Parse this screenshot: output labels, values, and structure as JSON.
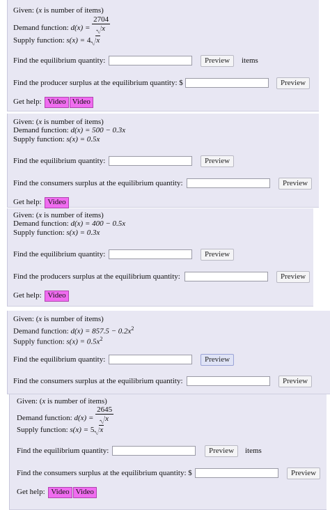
{
  "panels": [
    {
      "given": "Given: (",
      "given_var": "x",
      "given_rest": " is number of items)",
      "demand_label": "Demand function: ",
      "demand_lhs": "d(x) = ",
      "demand_num": "2704",
      "demand_den": "x",
      "supply_label": "Supply function: ",
      "supply_lhs": "s(x) = ",
      "supply_coef": "4",
      "supply_rad": "x",
      "q1": "Find the equilibrium quantity:",
      "preview1": "Preview",
      "unit": "items",
      "q2": "Find the producer surplus at the equilibrium quantity: $",
      "preview2": "Preview",
      "help": "Get help:",
      "video1": "Video",
      "video2": "Video"
    },
    {
      "given": "Given: (",
      "given_var": "x",
      "given_rest": " is number of items)",
      "demand_label": "Demand function: ",
      "demand_expr": "d(x) = 500 − 0.3x",
      "supply_label": "Supply function: ",
      "supply_expr": "s(x) = 0.5x",
      "q1": "Find the equilibrium quantity:",
      "preview1": "Preview",
      "q2": "Find the consumers surplus at the equilibrium quantity:",
      "preview2": "Preview",
      "help": "Get help:",
      "video1": "Video"
    },
    {
      "given": "Given: (",
      "given_var": "x",
      "given_rest": " is number of items)",
      "demand_label": "Demand function: ",
      "demand_expr": "d(x) = 400 − 0.5x",
      "supply_label": "Supply function: ",
      "supply_expr": "s(x) = 0.3x",
      "q1": "Find the equilibrium quantity:",
      "preview1": "Preview",
      "q2": "Find the producers surplus at the equilibrium quantity:",
      "preview2": "Preview",
      "help": "Get help:",
      "video1": "Video"
    },
    {
      "given": "Given: (",
      "given_var": "x",
      "given_rest": " is number of items)",
      "demand_label": "Demand function: ",
      "demand_expr": "d(x) = 857.5 − 0.2x",
      "demand_exp": "2",
      "supply_label": "Supply function: ",
      "supply_expr": "s(x) = 0.5x",
      "supply_exp": "2",
      "q1": "Find the equilibrium quantity:",
      "preview1": "Preview",
      "q2": "Find the consumers surplus at the equilibrium quantity:",
      "preview2": "Preview"
    },
    {
      "given": "Given: (",
      "given_var": "x",
      "given_rest": " is number of items)",
      "demand_label": "Demand function: ",
      "demand_lhs": "d(x) = ",
      "demand_num": "2645",
      "demand_den": "x",
      "supply_label": "Supply function: ",
      "supply_lhs": "s(x) = ",
      "supply_coef": "5",
      "supply_rad": "x",
      "q1": "Find the equilibrium quantity:",
      "preview1": "Preview",
      "unit": "items",
      "q2": "Find the consumers surplus at the equilibrium quantity: $",
      "preview2": "Preview",
      "help": "Get help:",
      "video1": "Video",
      "video2": "Video"
    }
  ],
  "colors": {
    "panel_bg": "#e8e7f3",
    "video_bg": "#f06cf0"
  }
}
